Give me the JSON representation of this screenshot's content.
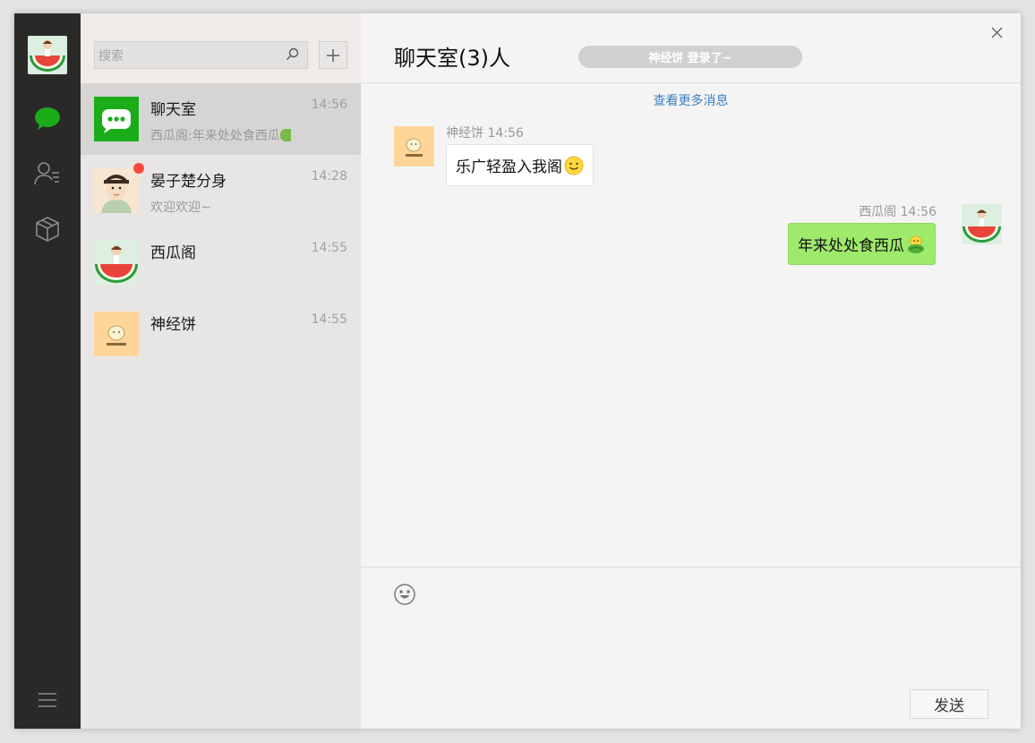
{
  "search": {
    "placeholder": "搜索"
  },
  "sessions": [
    {
      "name": "聊天室",
      "time": "14:56",
      "preview": "西瓜阁:年来处处食西瓜",
      "active": true
    },
    {
      "name": "晏子楚分身",
      "time": "14:28",
      "preview": "欢迎欢迎~",
      "unread": true
    },
    {
      "name": "西瓜阁",
      "time": "14:55",
      "preview": ""
    },
    {
      "name": "神经饼",
      "time": "14:55",
      "preview": ""
    }
  ],
  "chat": {
    "title": "聊天室(3)人",
    "status": "神经饼 登录了~",
    "more_link": "查看更多消息",
    "messages": [
      {
        "sender": "神经饼",
        "time": "14:56",
        "text": "乐广轻盈入我阁",
        "side": "left"
      },
      {
        "sender": "西瓜阁",
        "time": "14:56",
        "text": "年来处处食西瓜",
        "side": "right"
      }
    ],
    "send_label": "发送"
  },
  "colors": {
    "nav_bg": "#2b2828",
    "accent": "#1aad19",
    "bubble_self": "#9eea6a",
    "badge": "#fa4a3d"
  }
}
